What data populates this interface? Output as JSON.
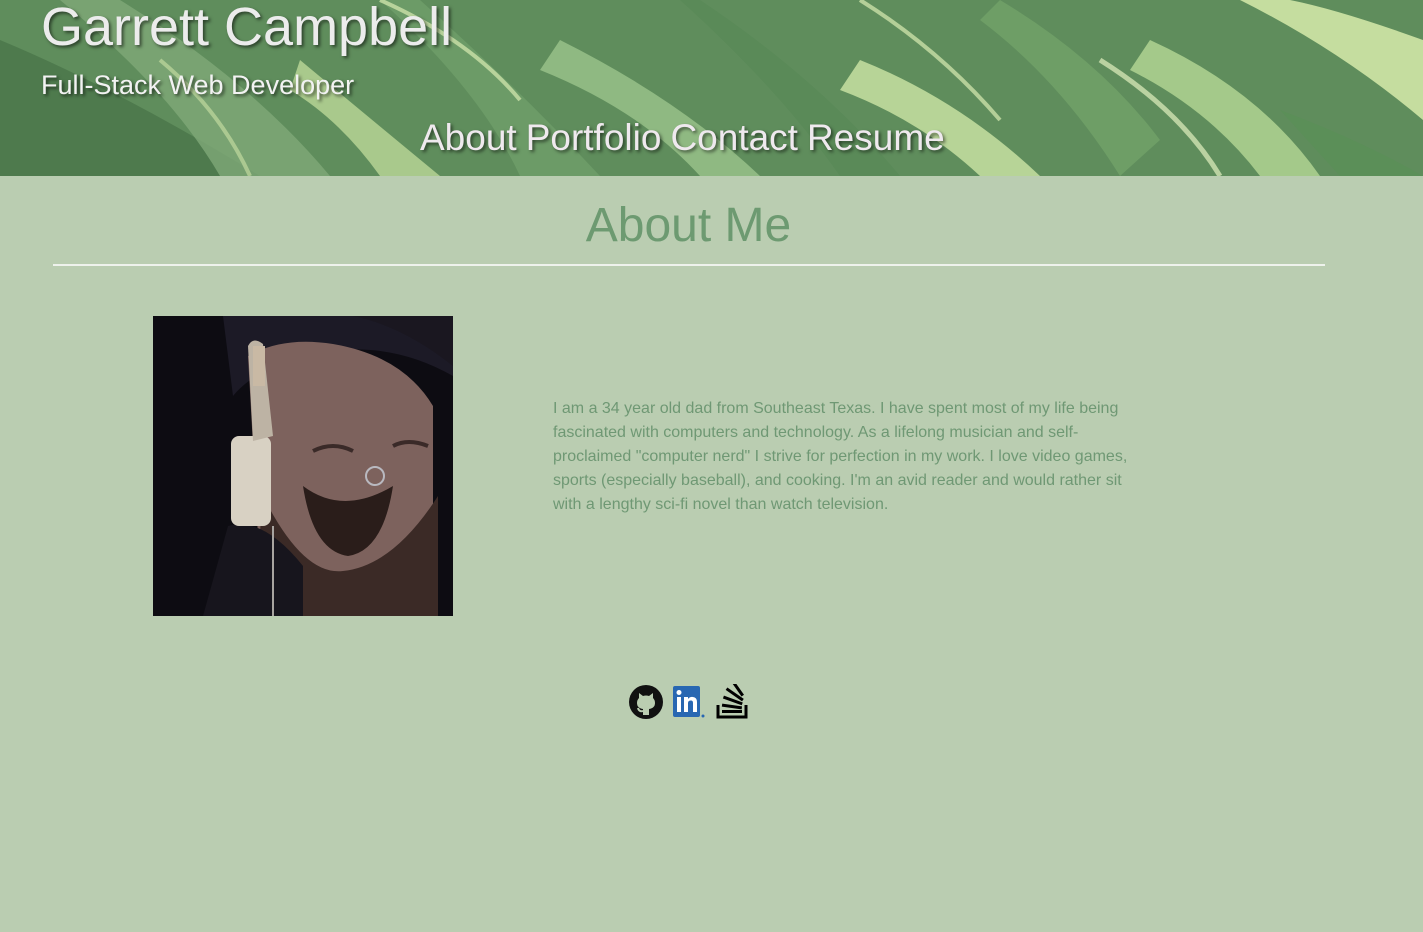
{
  "header": {
    "name": "Garrett Campbell",
    "subtitle": "Full-Stack Web Developer"
  },
  "nav": {
    "items": [
      {
        "label": "About"
      },
      {
        "label": "Portfolio"
      },
      {
        "label": "Contact"
      },
      {
        "label": "Resume"
      }
    ]
  },
  "about": {
    "heading": "About Me",
    "bio": "I am a 34 year old dad from Southeast Texas. I have spent most of my life being fascinated with computers and technology. As a lifelong musician and self-proclaimed \"computer nerd\" I strive for perfection in my work. I love video games, sports (especially baseball), and cooking. I'm an avid reader and would rather sit with a lengthy sci-fi novel than watch television."
  },
  "social": {
    "icons": [
      "github-icon",
      "linkedin-icon",
      "stackoverflow-icon"
    ]
  },
  "colors": {
    "page_background": "#bacdb1",
    "heading_green": "#6d9a71",
    "bio_text": "#6f9874",
    "linkedin_blue": "#2867b2"
  }
}
